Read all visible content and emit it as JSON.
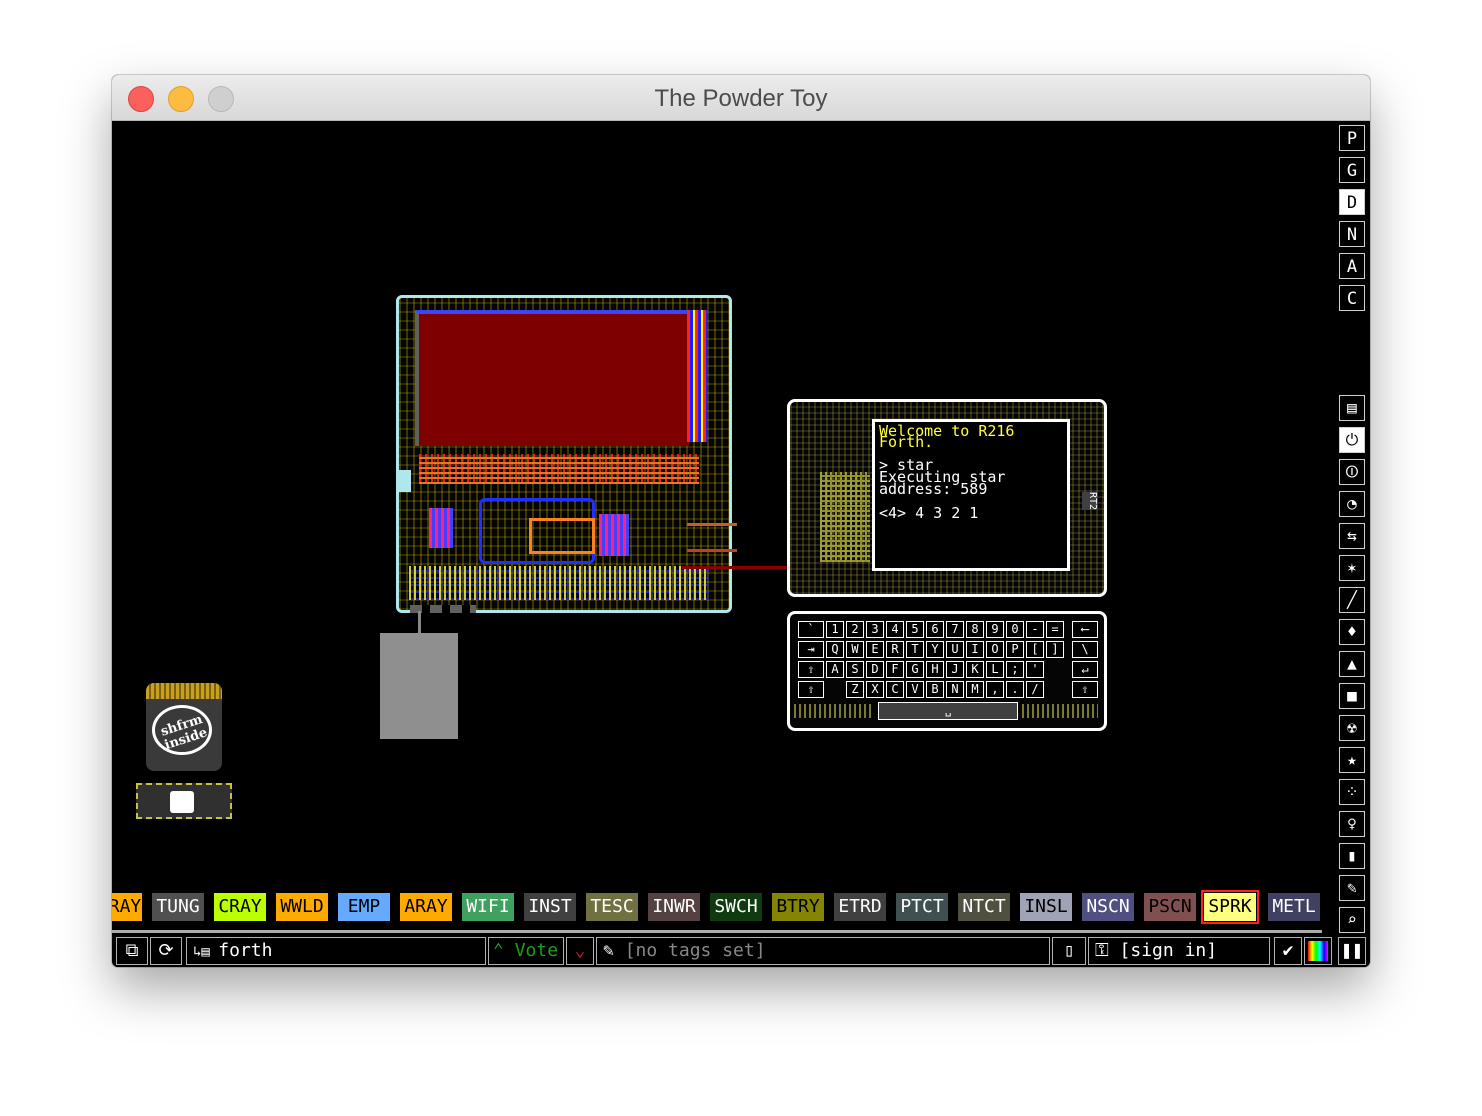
{
  "window": {
    "title": "The Powder Toy"
  },
  "right_menu": {
    "letters": [
      "P",
      "G",
      "D",
      "N",
      "A",
      "C"
    ],
    "active_letter": "D",
    "categories": [
      "walls-icon",
      "electronics-icon",
      "powered-icon",
      "sensors-icon",
      "force-icon",
      "explosives-icon",
      "gases-icon",
      "liquids-icon",
      "powders-icon",
      "solids-icon",
      "radioactive-icon",
      "special-icon",
      "life-icon",
      "tools-icon",
      "favorites-icon",
      "decoration-icon",
      "search-icon"
    ],
    "active_category": "electronics-icon"
  },
  "elements": [
    {
      "label": "RAY",
      "bg": "#ffaa00",
      "fg": "#000000"
    },
    {
      "label": "TUNG",
      "bg": "#505050",
      "fg": "#ffffff"
    },
    {
      "label": "CRAY",
      "bg": "#bbff00",
      "fg": "#000000"
    },
    {
      "label": "WWLD",
      "bg": "#ffaa00",
      "fg": "#000000"
    },
    {
      "label": "EMP",
      "bg": "#66aaff",
      "fg": "#000000"
    },
    {
      "label": "ARAY",
      "bg": "#ffaa00",
      "fg": "#000000"
    },
    {
      "label": "WIFI",
      "bg": "#40a060",
      "fg": "#ffffff"
    },
    {
      "label": "INST",
      "bg": "#404040",
      "fg": "#ffffff"
    },
    {
      "label": "TESC",
      "bg": "#707040",
      "fg": "#ffffff"
    },
    {
      "label": "INWR",
      "bg": "#544141",
      "fg": "#ffffff"
    },
    {
      "label": "SWCH",
      "bg": "#103b11",
      "fg": "#ffffff"
    },
    {
      "label": "BTRY",
      "bg": "#858505",
      "fg": "#000000"
    },
    {
      "label": "ETRD",
      "bg": "#404040",
      "fg": "#ffffff"
    },
    {
      "label": "PTCT",
      "bg": "#405050",
      "fg": "#ffffff"
    },
    {
      "label": "NTCT",
      "bg": "#505040",
      "fg": "#ffffff"
    },
    {
      "label": "INSL",
      "bg": "#9ea3b6",
      "fg": "#000000"
    },
    {
      "label": "NSCN",
      "bg": "#505080",
      "fg": "#ffffff"
    },
    {
      "label": "PSCN",
      "bg": "#805050",
      "fg": "#000000"
    },
    {
      "label": "SPRK",
      "bg": "#ffff80",
      "fg": "#000000",
      "selected": true
    },
    {
      "label": "METL",
      "bg": "#404060",
      "fg": "#ffffff"
    }
  ],
  "bottom_bar": {
    "open_icon": "open-icon",
    "reload_icon": "reload-icon",
    "save_name": "forth",
    "vote_label": "Vote",
    "tags": "[no tags set]",
    "sign_in": "[sign in]"
  },
  "terminal": {
    "lines": [
      "Welcome to R216",
      "Forth.",
      "",
      "> star",
      "Executing star",
      "address: 589",
      "",
      "<4> 4 3 2 1"
    ],
    "side_label": "RT2"
  },
  "keyboard": {
    "rows": [
      [
        "`",
        "1",
        "2",
        "3",
        "4",
        "5",
        "6",
        "7",
        "8",
        "9",
        "0",
        "-",
        "=",
        "⟵"
      ],
      [
        "⇥",
        "Q",
        "W",
        "E",
        "R",
        "T",
        "Y",
        "U",
        "I",
        "O",
        "P",
        "[",
        "]",
        "\\"
      ],
      [
        "⇪",
        "A",
        "S",
        "D",
        "F",
        "G",
        "H",
        "J",
        "K",
        "L",
        ";",
        "'",
        "↵"
      ],
      [
        "⇧",
        "Z",
        "X",
        "C",
        "V",
        "B",
        "N",
        "M",
        ",",
        ".",
        "/",
        "⇧"
      ]
    ],
    "space": "␣"
  },
  "logo": {
    "text": "shfrm inside"
  },
  "colors": {
    "accent_red": "#7f0000",
    "board_outline": "#aee8ee"
  }
}
